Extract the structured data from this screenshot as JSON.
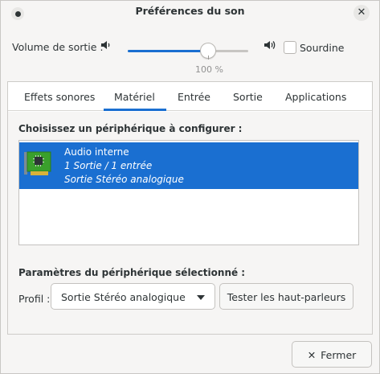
{
  "window": {
    "title": "Préférences du son"
  },
  "volume": {
    "label": "Volume de sortie :",
    "level_percent": 100,
    "level_text": "100 %",
    "mute_label": "Sourdine",
    "mute_checked": false
  },
  "tabs": [
    {
      "label": "Effets sonores",
      "selected": false
    },
    {
      "label": "Matériel",
      "selected": true
    },
    {
      "label": "Entrée",
      "selected": false
    },
    {
      "label": "Sortie",
      "selected": false
    },
    {
      "label": "Applications",
      "selected": false
    }
  ],
  "hardware": {
    "choose_title": "Choisissez un périphérique à configurer :",
    "devices": [
      {
        "name": "Audio interne",
        "ports": "1 Sortie / 1 entrée",
        "profile": "Sortie Stéréo analogique",
        "selected": true
      }
    ],
    "settings_title": "Paramètres du périphérique sélectionné :",
    "profile_label": "Profil :",
    "profile_value": "Sortie Stéréo analogique",
    "test_button": "Tester les haut-parleurs"
  },
  "footer": {
    "close_label": "Fermer"
  },
  "colors": {
    "accent": "#1a6fd1",
    "window_bg": "#f6f5f4"
  },
  "icons": {
    "speaker_low": "speaker-low-icon",
    "speaker_high": "speaker-high-icon",
    "sound_card": "sound-card-icon",
    "close": "close-icon"
  }
}
